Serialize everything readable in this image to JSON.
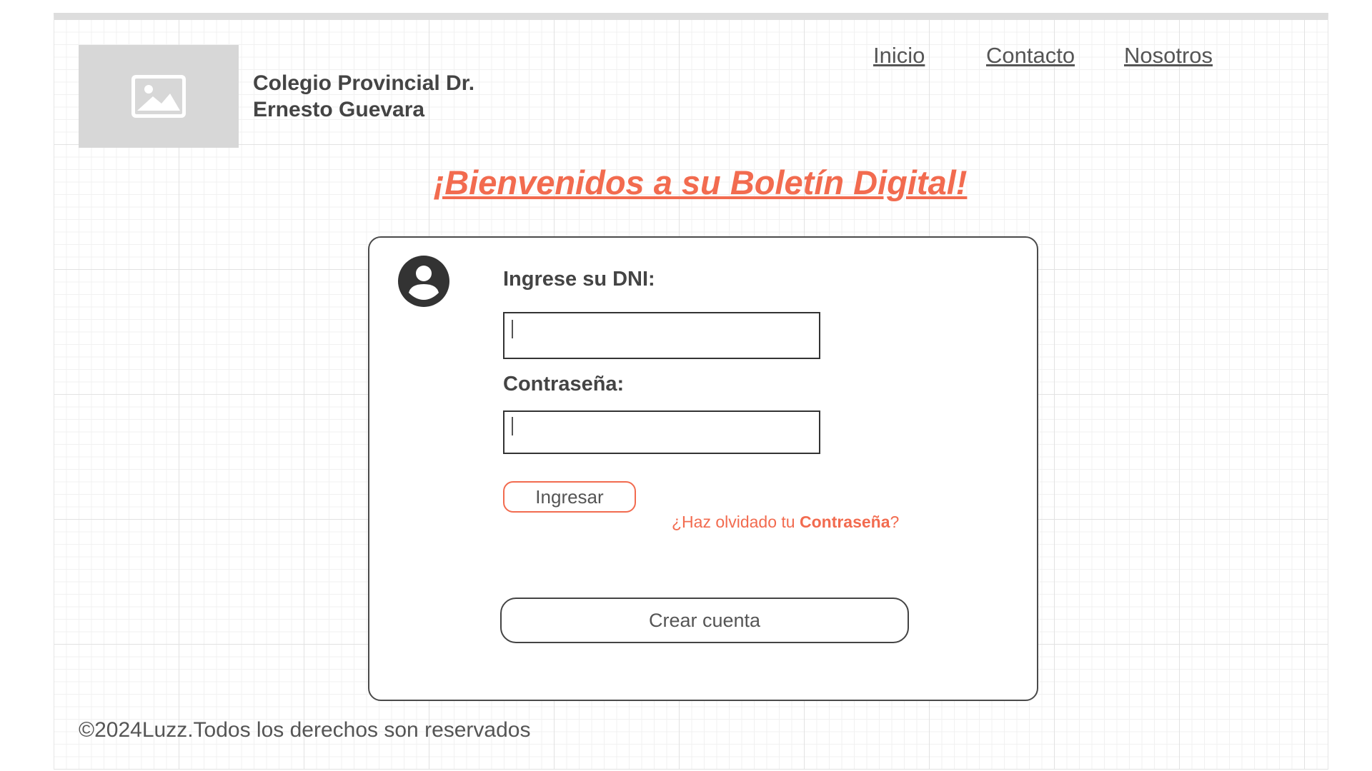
{
  "header": {
    "school_name_line1": "Colegio Provincial Dr.",
    "school_name_line2": "Ernesto Guevara",
    "logo_icon": "image-placeholder-icon",
    "nav": [
      {
        "label": "Inicio"
      },
      {
        "label": "Contacto"
      },
      {
        "label": "Nosotros"
      }
    ]
  },
  "welcome_title": "¡Bienvenidos a su Boletín Digital!",
  "login": {
    "user_icon": "user-circle-icon",
    "dni_label": "Ingrese su DNI:",
    "dni_value": "",
    "password_label": "Contraseña:",
    "password_value": "",
    "submit_label": "Ingresar",
    "forgot_prefix": "¿Haz olvidado tu ",
    "forgot_bold": "Contraseña",
    "forgot_suffix": "?",
    "create_account_label": "Crear cuenta"
  },
  "footer": {
    "copyright": "©2024Luzz.Todos los derechos son reservados"
  },
  "colors": {
    "accent": "#f26b4f",
    "text": "#444444",
    "placeholder_gray": "#d7d7d7"
  }
}
